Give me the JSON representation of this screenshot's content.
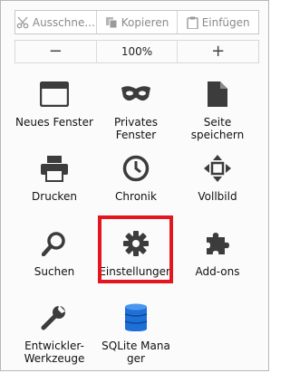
{
  "edit_row": {
    "cut_label": "Ausschne...",
    "copy_label": "Kopieren",
    "paste_label": "Einfügen"
  },
  "zoom_row": {
    "minus_label": "−",
    "zoom_value": "100%",
    "plus_label": "+"
  },
  "menu_items": [
    {
      "label": "Neues Fenster",
      "icon": "window-icon"
    },
    {
      "label": "Privates\nFenster",
      "icon": "mask-icon"
    },
    {
      "label": "Seite\nspeichern",
      "icon": "page-icon"
    },
    {
      "label": "Drucken",
      "icon": "printer-icon"
    },
    {
      "label": "Chronik",
      "icon": "clock-icon"
    },
    {
      "label": "Vollbild",
      "icon": "fullscreen-icon"
    },
    {
      "label": "Suchen",
      "icon": "search-icon"
    },
    {
      "label": "Einstellungen",
      "icon": "gear-icon"
    },
    {
      "label": "Add-ons",
      "icon": "puzzle-icon"
    },
    {
      "label": "Entwickler-\nWerkzeuge",
      "icon": "wrench-icon"
    },
    {
      "label": "SQLite Mana\nger",
      "icon": "database-icon"
    }
  ],
  "colors": {
    "highlight": "#e4151f",
    "icon": "#3c3c3c",
    "database": "#1e6fd6"
  }
}
